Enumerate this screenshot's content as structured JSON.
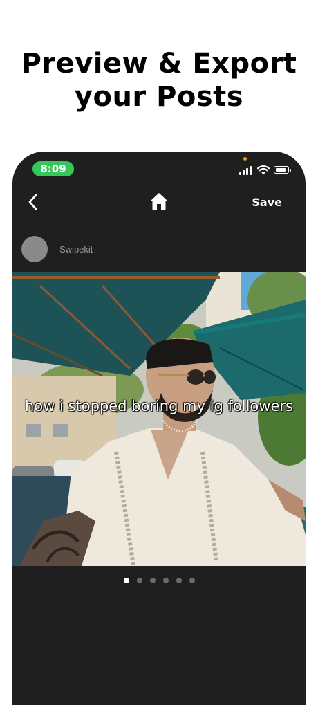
{
  "headline": {
    "line1": "Preview &  Export",
    "line2": "your Posts"
  },
  "status_bar": {
    "time": "8:09",
    "time_pill_color": "#34c759"
  },
  "nav": {
    "back_icon": "chevron-left-icon",
    "home_icon": "home-icon",
    "save_label": "Save"
  },
  "post": {
    "username": "Swipekit",
    "caption": "how i stopped boring my ig followers",
    "slide_count": 6,
    "active_slide": 1
  },
  "colors": {
    "phone_bg": "#1f1f1f",
    "accent_green": "#34c759",
    "dot_active": "#ffffff",
    "dot_inactive": "#6a6a6a"
  }
}
